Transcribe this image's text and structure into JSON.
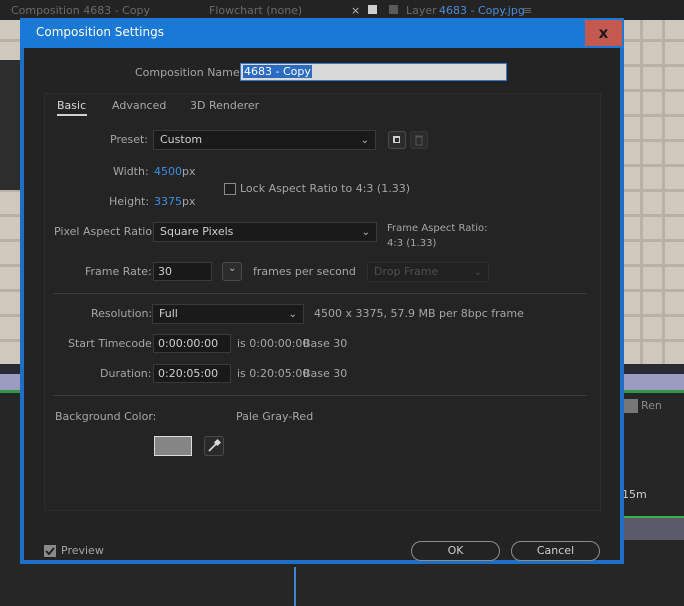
{
  "background": {
    "tabs": [
      {
        "label": "Composition 4683 - Copy"
      },
      {
        "label": "Flowchart  (none)"
      },
      {
        "label": "Layer"
      },
      {
        "label": "4683 - Copy.jpg"
      }
    ],
    "ruler_label": "15m",
    "render_label": "Ren"
  },
  "dialog": {
    "title": "Composition Settings",
    "close_glyph": "x",
    "composition_name_label": "Composition Name:",
    "composition_name_value": "4683 - Copy",
    "tabs": [
      {
        "label": "Basic",
        "active": true
      },
      {
        "label": "Advanced",
        "active": false
      },
      {
        "label": "3D Renderer",
        "active": false
      }
    ],
    "preset": {
      "label": "Preset:",
      "value": "Custom"
    },
    "width": {
      "label": "Width:",
      "value": "4500",
      "unit": "px"
    },
    "height": {
      "label": "Height:",
      "value": "3375",
      "unit": "px"
    },
    "lock_aspect": {
      "label": "Lock Aspect Ratio to 4:3 (1.33)",
      "checked": false
    },
    "pixel_aspect": {
      "label": "Pixel Aspect Ratio:",
      "value": "Square Pixels"
    },
    "frame_aspect": {
      "label": "Frame Aspect Ratio:",
      "value": "4:3 (1.33)"
    },
    "frame_rate": {
      "label": "Frame Rate:",
      "value": "30",
      "unit": "frames per second",
      "drop_frame": "Drop Frame"
    },
    "resolution": {
      "label": "Resolution:",
      "value": "Full",
      "info": "4500 x 3375, 57.9 MB per 8bpc frame"
    },
    "start_timecode": {
      "label": "Start Timecode:",
      "value": "0:00:00:00",
      "info": "is 0:00:00:00",
      "base": "Base 30"
    },
    "duration": {
      "label": "Duration:",
      "value": "0:20:05:00",
      "info": "is 0:20:05:00",
      "base": "Base 30"
    },
    "background_color": {
      "label": "Background Color:",
      "name": "Pale Gray-Red",
      "swatch": "#858585"
    },
    "preview": {
      "label": "Preview",
      "checked": true
    },
    "ok_label": "OK",
    "cancel_label": "Cancel"
  },
  "colors": {
    "accent": "#1a78d6",
    "value_blue": "#3f8fe0",
    "close": "#c45a4f"
  }
}
